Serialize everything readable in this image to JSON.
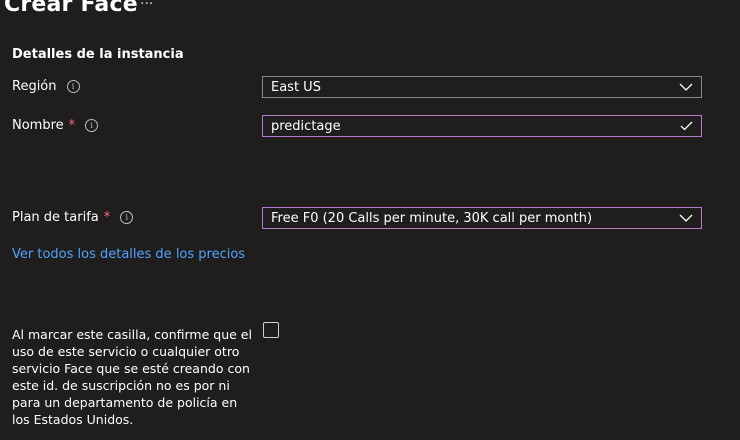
{
  "header": {
    "title": "Crear Face",
    "more_label": "···"
  },
  "section": {
    "heading": "Detalles de la instancia"
  },
  "region": {
    "label": "Región",
    "value": "East US",
    "icon": "info-icon"
  },
  "name": {
    "label": "Nombre",
    "required_marker": "*",
    "value": "predictage",
    "icon": "info-icon",
    "valid_icon": "checkmark-icon"
  },
  "plan": {
    "label": "Plan de tarifa",
    "required_marker": "*",
    "value": "Free F0 (20 Calls per minute, 30K call per month)",
    "icon": "info-icon"
  },
  "pricing_link": {
    "text": "Ver todos los detalles de los precios"
  },
  "consent": {
    "text": "Al marcar este casilla, confirme que el uso de este servicio o cualquier otro servicio Face que se esté creando con este id. de suscripción no es por ni para un departamento de policía en los Estados Unidos.",
    "checked": false
  },
  "colors": {
    "background": "#1f1e1d",
    "accent_border": "#b77bd6",
    "link": "#4fa3ff",
    "required": "#f1707b"
  }
}
